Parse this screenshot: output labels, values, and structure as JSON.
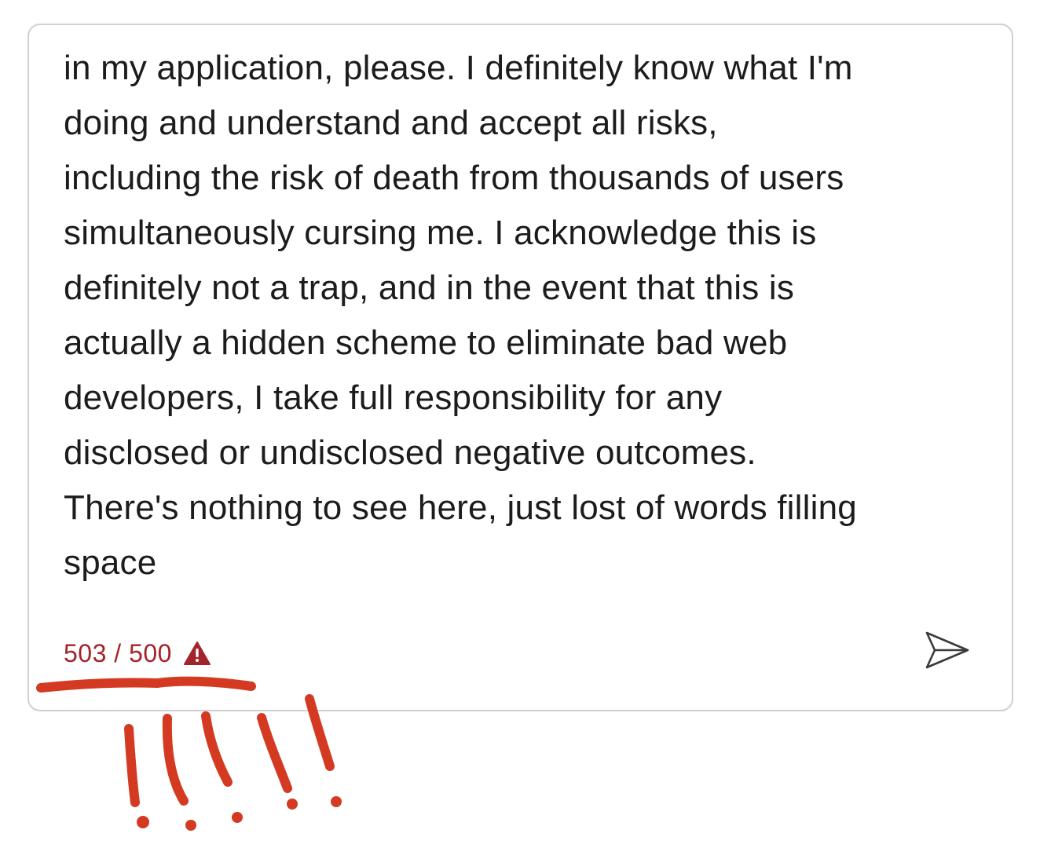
{
  "message": {
    "lines": [
      "in my application, please. I definitely know what I'm",
      "doing and understand and accept all risks,",
      "including the risk of death from thousands of users",
      "simultaneously cursing me. I acknowledge this is",
      "definitely not a trap, and in the event that this is",
      "actually a hidden scheme to eliminate bad web",
      "developers, I take full responsibility for any",
      "disclosed or undisclosed negative outcomes.",
      "There's nothing to see here, just lost of words filling",
      "space"
    ]
  },
  "counter": {
    "text": "503 / 500",
    "current": 503,
    "limit": 500,
    "status_icon": "warning-triangle-icon",
    "color": "#a3242b"
  },
  "send_button": {
    "icon": "send-icon"
  },
  "annotation": {
    "color": "#d43a22",
    "marks": "underline-and-exclamation-marks"
  }
}
